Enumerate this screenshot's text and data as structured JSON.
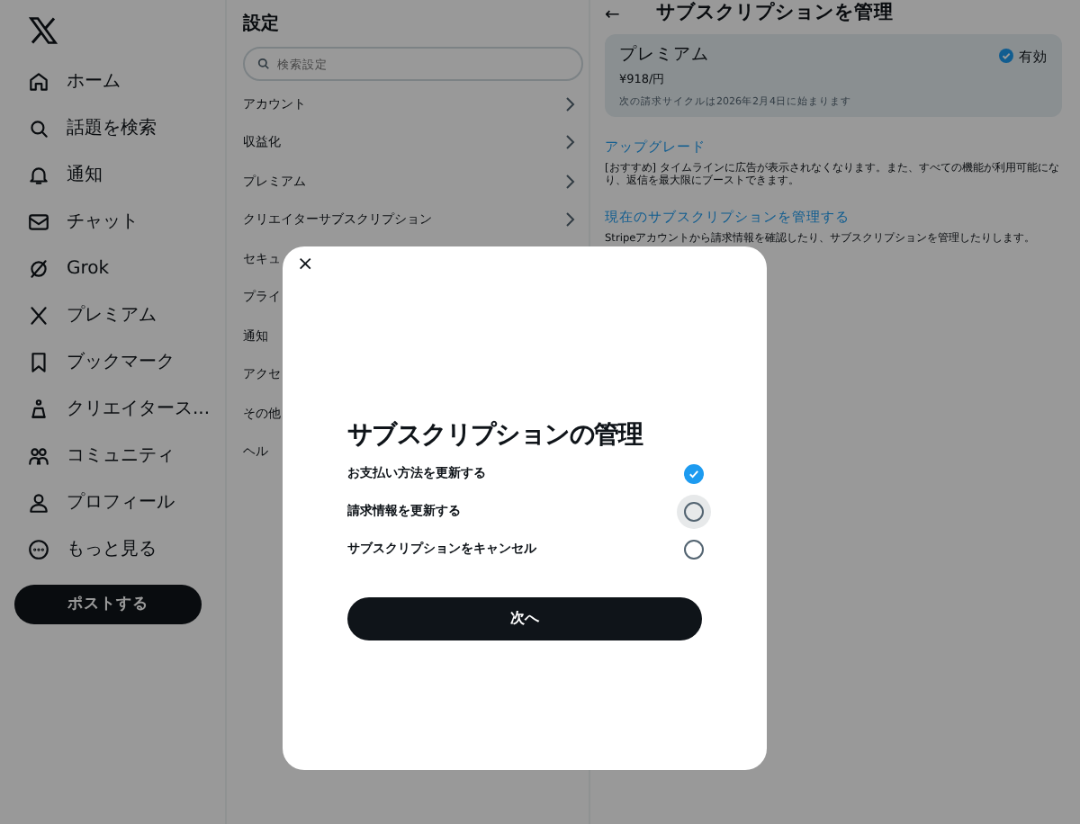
{
  "sidebar": {
    "items": [
      {
        "label": "ホーム"
      },
      {
        "label": "話題を検索"
      },
      {
        "label": "通知"
      },
      {
        "label": "チャット"
      },
      {
        "label": "Grok"
      },
      {
        "label": "プレミアム"
      },
      {
        "label": "ブックマーク"
      },
      {
        "label": "クリエイタース..."
      },
      {
        "label": "コミュニティ"
      },
      {
        "label": "プロフィール"
      },
      {
        "label": "もっと見る"
      }
    ],
    "post_button": "ポストする"
  },
  "settings": {
    "title": "設定",
    "search": {
      "placeholder": "検索設定"
    },
    "items": [
      {
        "label": "アカウント",
        "chevron": true
      },
      {
        "label": "収益化",
        "chevron": true
      },
      {
        "label": "プレミアム",
        "chevron": true
      },
      {
        "label": "クリエイターサブスクリプション",
        "chevron": true
      },
      {
        "label": "セキュ",
        "chevron": false
      },
      {
        "label": "プライ",
        "chevron": false
      },
      {
        "label": "通知",
        "chevron": false
      },
      {
        "label": "アクセ",
        "chevron": false
      },
      {
        "label": "その他",
        "chevron": false
      },
      {
        "label": "ヘル",
        "chevron": false
      }
    ]
  },
  "subscription": {
    "back": "←",
    "title": "サブスクリプションを管理",
    "card": {
      "name": "プレミアム",
      "status": "有効",
      "price": "¥918/円",
      "note": "次の請求サイクルは2026年2月4日に始まります"
    },
    "sections": [
      {
        "link": "アップグレード",
        "description": "[おすすめ] タイムラインに広告が表示されなくなります。また、すべての機能が利用可能になり、返信を最大限にブーストできます。"
      },
      {
        "link": "現在のサブスクリプションを管理する",
        "description": "Stripeアカウントから請求情報を確認したり、サブスクリプションを管理したりします。"
      }
    ]
  },
  "modal": {
    "close": "×",
    "title": "サブスクリプションの管理",
    "options": [
      {
        "label": "お支払い方法を更新する",
        "selected": true,
        "hovered": false
      },
      {
        "label": "請求情報を更新する",
        "selected": false,
        "hovered": true
      },
      {
        "label": "サブスクリプションをキャンセル",
        "selected": false,
        "hovered": false
      }
    ],
    "next_button": "次へ"
  }
}
